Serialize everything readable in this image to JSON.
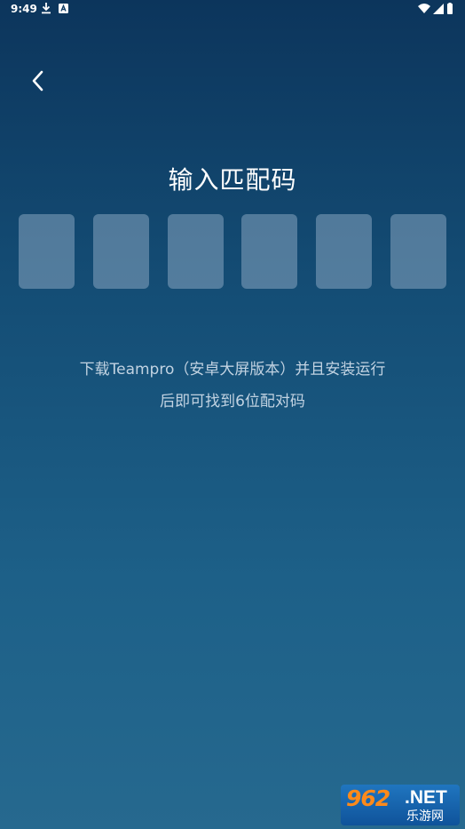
{
  "status_bar": {
    "time": "9:49",
    "icons": [
      "download-icon",
      "a-badge-icon",
      "wifi-icon",
      "signal-icon",
      "battery-icon"
    ]
  },
  "header": {
    "back_icon": "chevron-left-icon"
  },
  "main": {
    "title": "输入匹配码",
    "code_boxes": [
      "",
      "",
      "",
      "",
      "",
      ""
    ],
    "hint_line1": "下载Teampro（安卓大屏版本）并且安装运行",
    "hint_line2": "后即可找到6位配对码"
  },
  "watermark": {
    "number": "962",
    "suffix": ".NET",
    "subtitle": "乐游网"
  },
  "colors": {
    "bg_top": "#0c355c",
    "bg_bottom": "#26698f",
    "code_box": "#5b7f9c",
    "hint_text": "#c2d3e2"
  }
}
